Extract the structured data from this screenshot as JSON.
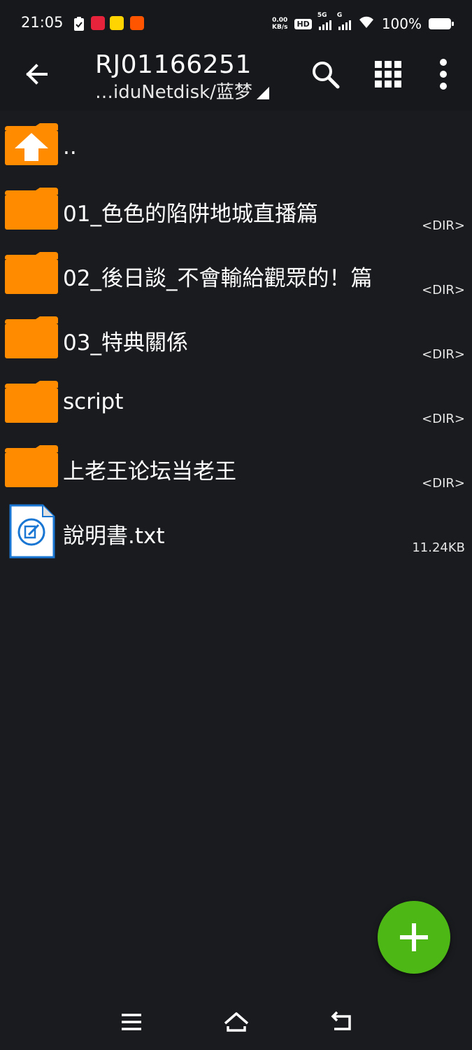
{
  "status_bar": {
    "time": "21:05",
    "net_speed_value": "0.00",
    "net_speed_unit": "KB/s",
    "hd": "HD",
    "net_type_1": "5G",
    "net_type_2": "G",
    "battery": "100%"
  },
  "app_bar": {
    "title": "RJ01166251",
    "path": "…iduNetdisk/蓝梦",
    "icons": [
      "arrow-left-icon",
      "search-icon",
      "grid-view-icon",
      "more-vert-icon"
    ]
  },
  "files": [
    {
      "type": "up",
      "name": "..",
      "meta": ""
    },
    {
      "type": "folder",
      "name": "01_色色的陷阱地城直播篇",
      "meta": "<DIR>"
    },
    {
      "type": "folder",
      "name": "02_後日談_不會輸給觀眾的！篇",
      "meta": "<DIR>"
    },
    {
      "type": "folder",
      "name": "03_特典關係",
      "meta": "<DIR>"
    },
    {
      "type": "folder",
      "name": "script",
      "meta": "<DIR>"
    },
    {
      "type": "folder",
      "name": "上老王论坛当老王",
      "meta": "<DIR>"
    },
    {
      "type": "text-file",
      "name": "說明書.txt",
      "meta": "11.24KB"
    }
  ],
  "colors": {
    "background": "#191b1e",
    "folder": "#ff8c00",
    "fab": "#4db815",
    "text_file_blue": "#1976d2"
  },
  "fab": {
    "icon": "plus-icon"
  },
  "nav_bar": {
    "icons": [
      "menu-icon",
      "home-icon",
      "back-icon"
    ]
  }
}
